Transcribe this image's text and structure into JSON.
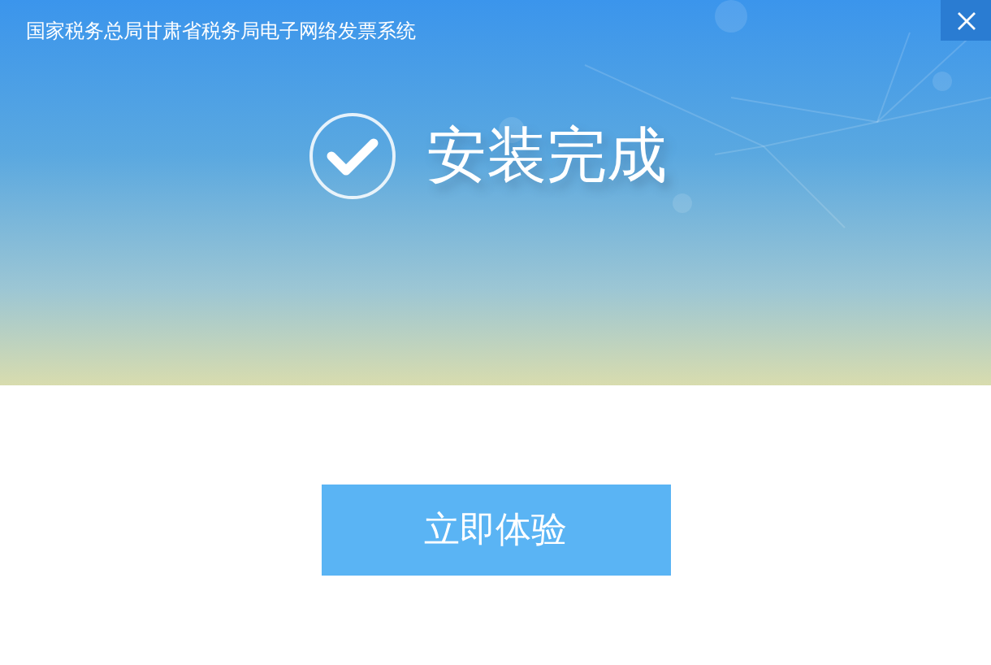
{
  "window": {
    "title": "国家税务总局甘肃省税务局电子网络发票系统"
  },
  "status": {
    "message": "安装完成"
  },
  "buttons": [
    "立即体验"
  ]
}
